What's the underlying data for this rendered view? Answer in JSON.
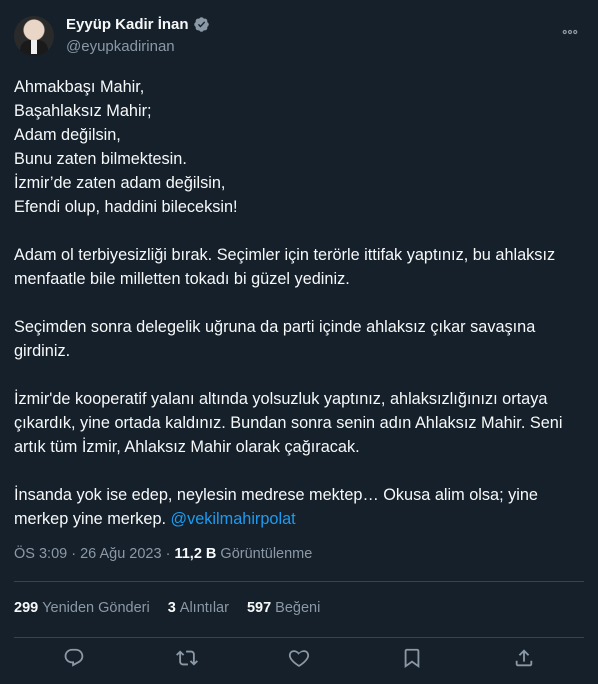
{
  "author": {
    "name": "Eyyüp Kadir İnan",
    "handle": "@eyupkadirinan"
  },
  "tweet": {
    "paragraph1": "Ahmakbaşı Mahir,\nBaşahlaksız Mahir;\nAdam değilsin,\nBunu zaten bilmektesin.\nİzmir’de zaten adam değilsin,\nEfendi olup, haddini bileceksin!",
    "paragraph2": "Adam ol terbiyesizliği bırak. Seçimler için terörle ittifak yaptınız, bu ahlaksız menfaatle bile milletten tokadı bi güzel yediniz.",
    "paragraph3": "Seçimden sonra delegelik uğruna da parti içinde ahlaksız çıkar savaşına girdiniz.",
    "paragraph4": "İzmir'de kooperatif yalanı altında yolsuzluk yaptınız, ahlaksızlığınızı ortaya çıkardık, yine ortada kaldınız. Bundan sonra senin adın Ahlaksız Mahir. Seni artık tüm İzmir, Ahlaksız Mahir olarak çağıracak.",
    "paragraph5": "İnsanda yok ise edep, neylesin medrese mektep… Okusa alim olsa; yine merkep yine merkep. ",
    "mention": "@vekilmahirpolat"
  },
  "meta": {
    "time": "ÖS 3:09",
    "separator": "·",
    "date": "26 Ağu 2023",
    "views_count": "11,2 B",
    "views_label": "Görüntülenme"
  },
  "stats": {
    "retweets_count": "299",
    "retweets_label": "Yeniden Gönderi",
    "quotes_count": "3",
    "quotes_label": "Alıntılar",
    "likes_count": "597",
    "likes_label": "Beğeni"
  },
  "colors": {
    "background": "#15202b",
    "text": "#f7f9f9",
    "secondary": "#8b98a5",
    "accent": "#1d9bf0",
    "divider": "#38444d"
  },
  "icons": {
    "reply": "reply-icon",
    "retweet": "retweet-icon",
    "like": "heart-icon",
    "bookmark": "bookmark-icon",
    "share": "share-icon",
    "verified": "verified-badge-icon",
    "more": "more-icon"
  }
}
